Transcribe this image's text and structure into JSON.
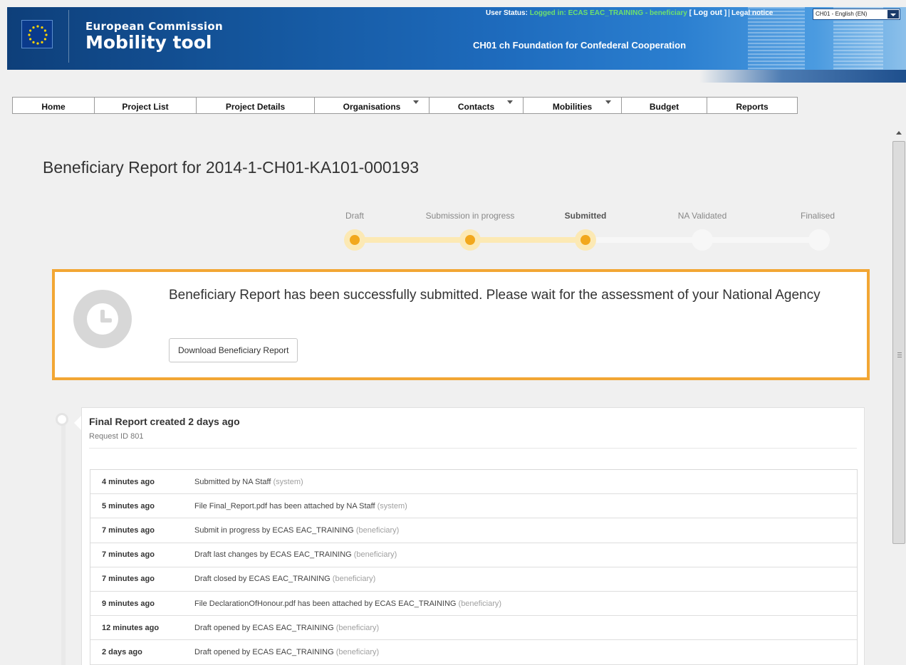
{
  "header": {
    "brand_top": "European Commission",
    "brand_main": "Mobility tool",
    "organisation": "CH01 ch Foundation for Confederal Cooperation",
    "status_label": "User Status:",
    "status_login": "Logged in: ECAS EAC_TRAINING -",
    "status_role": "beneficiary",
    "bracket_open": "[",
    "logout": "Log out",
    "bracket_close": "]",
    "legal_notice": "Legal notice",
    "language": "CH01 - English (EN)"
  },
  "nav": [
    {
      "label": "Home",
      "dropdown": false
    },
    {
      "label": "Project List",
      "dropdown": false
    },
    {
      "label": "Project Details",
      "dropdown": false
    },
    {
      "label": "Organisations",
      "dropdown": true
    },
    {
      "label": "Contacts",
      "dropdown": true
    },
    {
      "label": "Mobilities",
      "dropdown": true
    },
    {
      "label": "Budget",
      "dropdown": false
    },
    {
      "label": "Reports",
      "dropdown": false
    }
  ],
  "page_title": "Beneficiary Report for 2014-1-CH01-KA101-000193",
  "steps": [
    {
      "label": "Draft",
      "state": "done"
    },
    {
      "label": "Submission in progress",
      "state": "done"
    },
    {
      "label": "Submitted",
      "state": "current"
    },
    {
      "label": "NA Validated",
      "state": "todo"
    },
    {
      "label": "Finalised",
      "state": "todo"
    }
  ],
  "alert": {
    "icon": "clock-icon",
    "message": "Beneficiary Report has been successfully submitted. Please wait for the assessment of your National Agency",
    "button": "Download Beneficiary Report",
    "border_color": "#f2a634"
  },
  "timeline": {
    "title": "Final Report created 2 days ago",
    "request_id": "Request ID 801",
    "entries": [
      {
        "time": "4 minutes ago",
        "text": "Submitted by NA Staff",
        "role": "(system)"
      },
      {
        "time": "5 minutes ago",
        "text": "File Final_Report.pdf has been attached by NA Staff",
        "role": "(system)"
      },
      {
        "time": "7 minutes ago",
        "text": "Submit in progress by ECAS EAC_TRAINING",
        "role": "(beneficiary)"
      },
      {
        "time": "7 minutes ago",
        "text": "Draft last changes by ECAS EAC_TRAINING",
        "role": "(beneficiary)"
      },
      {
        "time": "7 minutes ago",
        "text": "Draft closed by ECAS EAC_TRAINING",
        "role": "(beneficiary)"
      },
      {
        "time": "9 minutes ago",
        "text": "File DeclarationOfHonour.pdf has been attached by ECAS EAC_TRAINING",
        "role": "(beneficiary)"
      },
      {
        "time": "12 minutes ago",
        "text": "Draft opened by ECAS EAC_TRAINING",
        "role": "(beneficiary)"
      },
      {
        "time": "2 days ago",
        "text": "Draft opened by ECAS EAC_TRAINING",
        "role": "(beneficiary)"
      }
    ]
  },
  "colors": {
    "progress_done": "#f2a81d",
    "progress_track_done": "#fce9b4",
    "progress_track_todo": "#f7f7f7"
  }
}
